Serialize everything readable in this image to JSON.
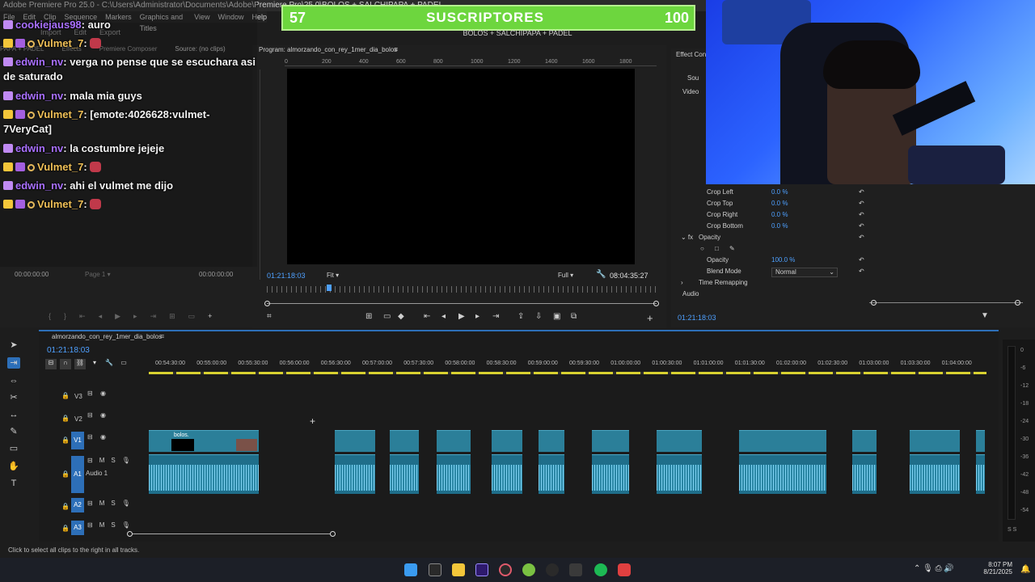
{
  "window": {
    "title": "Adobe Premiere Pro 25.0 - C:\\Users\\Administrator\\Documents\\Adobe\\Premiere Pro\\25.0\\BOLOS + SALCHIPAPA + PADEL",
    "menu": [
      "File",
      "Edit",
      "Clip",
      "Sequence",
      "Markers",
      "Graphics and Titles",
      "View",
      "Window",
      "Help"
    ],
    "workspace_tabs": [
      "Import",
      "Edit",
      "Export"
    ],
    "panel_tabs": [
      "PAPA + PADEL",
      "Effects",
      "Premiere Composer",
      "Source: (no clips)"
    ]
  },
  "chat": [
    {
      "user": "cookiejaus98",
      "text": "auro",
      "user_color": "#a970ff",
      "badges": [
        "sub"
      ]
    },
    {
      "user": "Vulmet_7",
      "text": "",
      "user_color": "#f0c057",
      "badges": [
        "crown",
        "gift",
        "ring"
      ],
      "emote": true
    },
    {
      "user": "edwin_nv",
      "text": "verga no pense que se escuchara asi de saturado",
      "user_color": "#a970ff",
      "badges": [
        "sub"
      ]
    },
    {
      "user": "edwin_nv",
      "text": "mala mia guys",
      "user_color": "#a970ff",
      "badges": [
        "sub"
      ]
    },
    {
      "user": "Vulmet_7",
      "text": "[emote:4026628:vulmet-7VeryCat]",
      "user_color": "#f0c057",
      "badges": [
        "crown",
        "gift",
        "ring"
      ]
    },
    {
      "user": "edwin_nv",
      "text": "la costumbre jejeje",
      "user_color": "#a970ff",
      "badges": [
        "sub"
      ]
    },
    {
      "user": "Vulmet_7",
      "text": "",
      "user_color": "#f0c057",
      "badges": [
        "crown",
        "gift",
        "ring"
      ],
      "emote": true
    },
    {
      "user": "edwin_nv",
      "text": "ahi el vulmet me dijo",
      "user_color": "#a970ff",
      "badges": [
        "sub"
      ]
    },
    {
      "user": "Vulmet_7",
      "text": "",
      "user_color": "#f0c057",
      "badges": [
        "crown",
        "gift",
        "ring"
      ],
      "emote": true
    }
  ],
  "subscriber_bar": {
    "current": "57",
    "label": "SUSCRIPTORES",
    "goal": "100",
    "progress": 0.57
  },
  "sequence_title": "BOLOS + SALCHIPAPA + PADEL",
  "source": {
    "timecode_left": "00:00:00:00",
    "page": "Page 1",
    "timecode_right": "00:00:00:00"
  },
  "program": {
    "title": "Program: almorzando_con_rey_1mer_dia_bolos",
    "ruler": [
      "0",
      "200",
      "400",
      "600",
      "800",
      "1000",
      "1200",
      "1400",
      "1600",
      "1800"
    ],
    "timecode": "01:21:18:03",
    "fit": "Fit",
    "quality": "Full",
    "duration": "08:04:35:27"
  },
  "effects": {
    "title": "Effect Contr",
    "source_label": "Sou",
    "video_label": "Video",
    "rows": [
      {
        "name": "Crop Left",
        "value": "0.0 %"
      },
      {
        "name": "Crop Top",
        "value": "0.0 %"
      },
      {
        "name": "Crop Right",
        "value": "0.0 %"
      },
      {
        "name": "Crop Bottom",
        "value": "0.0 %"
      }
    ],
    "opacity_group": "Opacity",
    "opacity_label": "Opacity",
    "opacity_value": "100.0 %",
    "blend_label": "Blend Mode",
    "blend_value": "Normal",
    "time_remap": "Time Remapping",
    "audio_label": "Audio",
    "timecode": "01:21:18:03"
  },
  "timeline": {
    "sequence_name": "almorzando_con_rey_1mer_dia_bolos",
    "timecode": "01:21:18:03",
    "ruler": [
      "00:54:30:00",
      "00:55:00:00",
      "00:55:30:00",
      "00:56:00:00",
      "00:56:30:00",
      "00:57:00:00",
      "00:57:30:00",
      "00:58:00:00",
      "00:58:30:00",
      "00:59:00:00",
      "00:59:30:00",
      "01:00:00:00",
      "01:00:30:00",
      "01:01:00:00",
      "01:01:30:00",
      "01:02:00:00",
      "01:02:30:00",
      "01:03:00:00",
      "01:03:30:00",
      "01:04:00:00"
    ],
    "tracks": [
      "V3",
      "V2",
      "V1",
      "A1",
      "A2",
      "A3"
    ],
    "audio_track_name": "Audio 1",
    "clip_label": "bolos.",
    "meter_labels": [
      "0",
      "-6",
      "-12",
      "-18",
      "-24",
      "-30",
      "-36",
      "-42",
      "-48",
      "-54"
    ],
    "meter_bottom": "S S"
  },
  "status_text": "Click to select all clips to the right in all tracks.",
  "taskbar": {
    "time": "8:07 PM",
    "date": "8/21/2025"
  }
}
